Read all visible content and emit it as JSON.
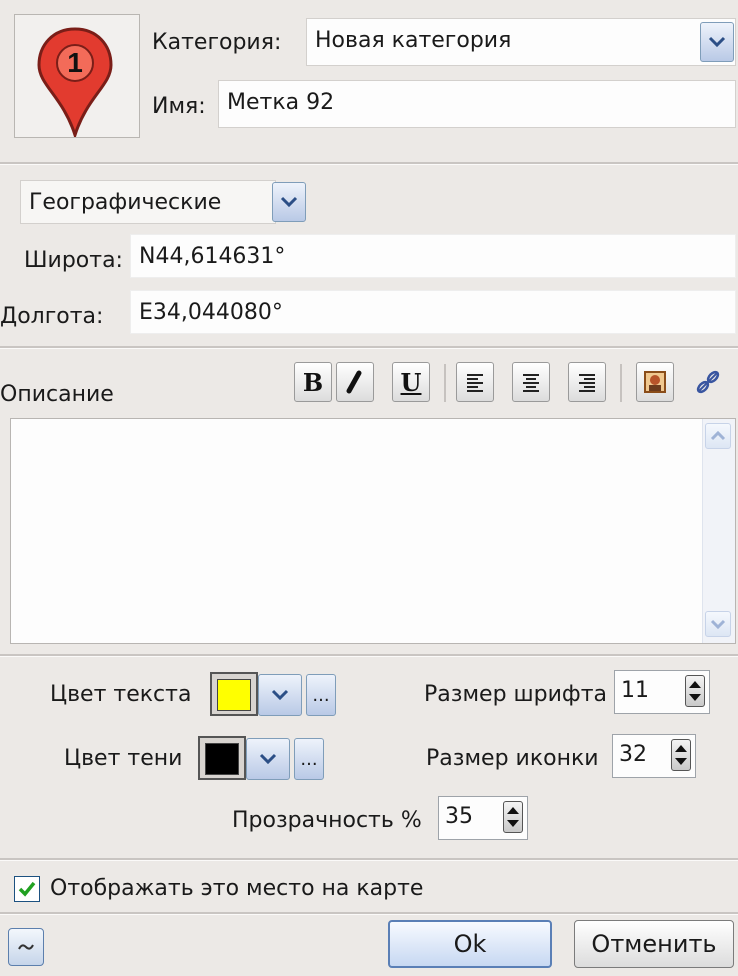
{
  "marker": {
    "number": "1",
    "icon": "map-pin-icon"
  },
  "header": {
    "category_label": "Категория:",
    "category_value": "Новая категория",
    "name_label": "Имя:",
    "name_value": "Метка 92"
  },
  "coords": {
    "format_value": "Географические",
    "latitude_label": "Широта:",
    "latitude_value": "N44,614631°",
    "longitude_label": "Долгота:",
    "longitude_value": "E34,044080°"
  },
  "description": {
    "label": "Описание",
    "toolbar": {
      "bold": "B",
      "italic": "I",
      "underline": "U",
      "align_left": "align-left-icon",
      "align_center": "align-center-icon",
      "align_right": "align-right-icon",
      "image": "image-icon",
      "link": "link-icon"
    },
    "value": ""
  },
  "style": {
    "text_color_label": "Цвет текста",
    "text_color": "#ffff00",
    "shadow_color_label": "Цвет тени",
    "shadow_color": "#000000",
    "more_button": "...",
    "font_size_label": "Размер шрифта",
    "font_size_value": "11",
    "icon_size_label": "Размер иконки",
    "icon_size_value": "32",
    "opacity_label": "Прозрачность %",
    "opacity_value": "35"
  },
  "show_on_map": {
    "checked": true,
    "label": "Отображать это место на карте"
  },
  "footer": {
    "collapse_icon": "wave-icon",
    "ok_label": "Ok",
    "cancel_label": "Отменить"
  }
}
